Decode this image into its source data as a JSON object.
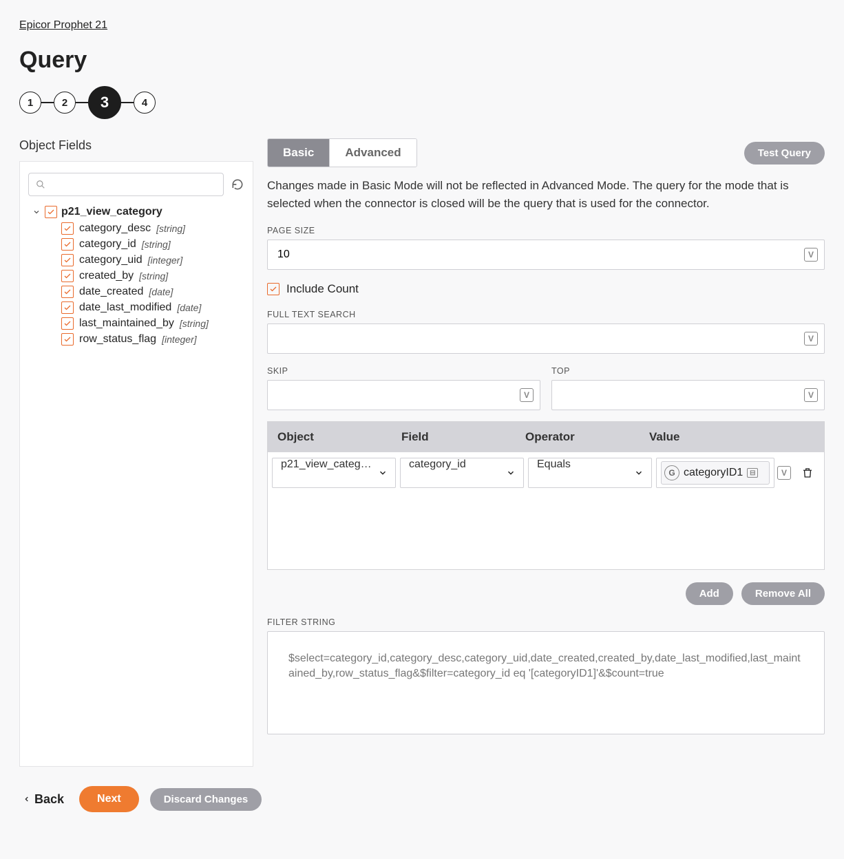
{
  "breadcrumb": "Epicor Prophet 21",
  "page_title": "Query",
  "stepper": {
    "steps": [
      "1",
      "2",
      "3",
      "4"
    ],
    "active_index": 2
  },
  "left": {
    "title": "Object Fields",
    "search_placeholder": "",
    "root": {
      "label": "p21_view_category",
      "children": [
        {
          "name": "category_desc",
          "type": "[string]"
        },
        {
          "name": "category_id",
          "type": "[string]"
        },
        {
          "name": "category_uid",
          "type": "[integer]"
        },
        {
          "name": "created_by",
          "type": "[string]"
        },
        {
          "name": "date_created",
          "type": "[date]"
        },
        {
          "name": "date_last_modified",
          "type": "[date]"
        },
        {
          "name": "last_maintained_by",
          "type": "[string]"
        },
        {
          "name": "row_status_flag",
          "type": "[integer]"
        }
      ]
    }
  },
  "right": {
    "tabs": {
      "basic": "Basic",
      "advanced": "Advanced"
    },
    "test_query": "Test Query",
    "info": "Changes made in Basic Mode will not be reflected in Advanced Mode. The query for the mode that is selected when the connector is closed will be the query that is used for the connector.",
    "page_size_label": "PAGE SIZE",
    "page_size_value": "10",
    "include_count_label": "Include Count",
    "full_text_label": "FULL TEXT SEARCH",
    "full_text_value": "",
    "skip_label": "SKIP",
    "skip_value": "",
    "top_label": "TOP",
    "top_value": "",
    "table": {
      "headers": {
        "object": "Object",
        "field": "Field",
        "operator": "Operator",
        "value": "Value"
      },
      "row": {
        "object": "p21_view_catego…",
        "field": "category_id",
        "operator": "Equals",
        "value_badge": "G",
        "value": "categoryID1"
      }
    },
    "add": "Add",
    "remove_all": "Remove All",
    "filter_string_label": "FILTER STRING",
    "filter_string_value": "$select=category_id,category_desc,category_uid,date_created,created_by,date_last_modified,last_maintained_by,row_status_flag&$filter=category_id eq '[categoryID1]'&$count=true"
  },
  "footer": {
    "back": "Back",
    "next": "Next",
    "discard": "Discard Changes"
  }
}
